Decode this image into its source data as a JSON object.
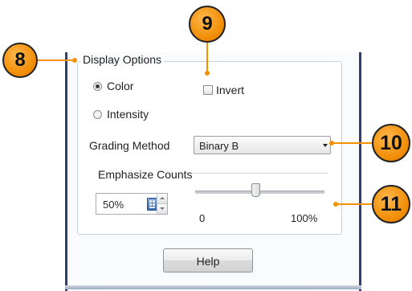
{
  "display_options": {
    "title": "Display Options",
    "color_label": "Color",
    "color_selected": true,
    "intensity_label": "Intensity",
    "invert_label": "Invert",
    "invert_checked": false
  },
  "grading": {
    "label": "Grading Method",
    "value": "Binary B"
  },
  "emphasize": {
    "label": "Emphasize Counts",
    "value": "50%",
    "slider_min_label": "0",
    "slider_max_label": "100%",
    "slider_value_percent": 50
  },
  "help_label": "Help",
  "callouts": [
    "8",
    "9",
    "10",
    "11"
  ],
  "colors": {
    "callout": "#f39200",
    "frame": "#2c3f72"
  },
  "icons": {
    "spinner_calculator": "calculator-icon",
    "dropdown_arrow": "chevron-down-icon"
  }
}
